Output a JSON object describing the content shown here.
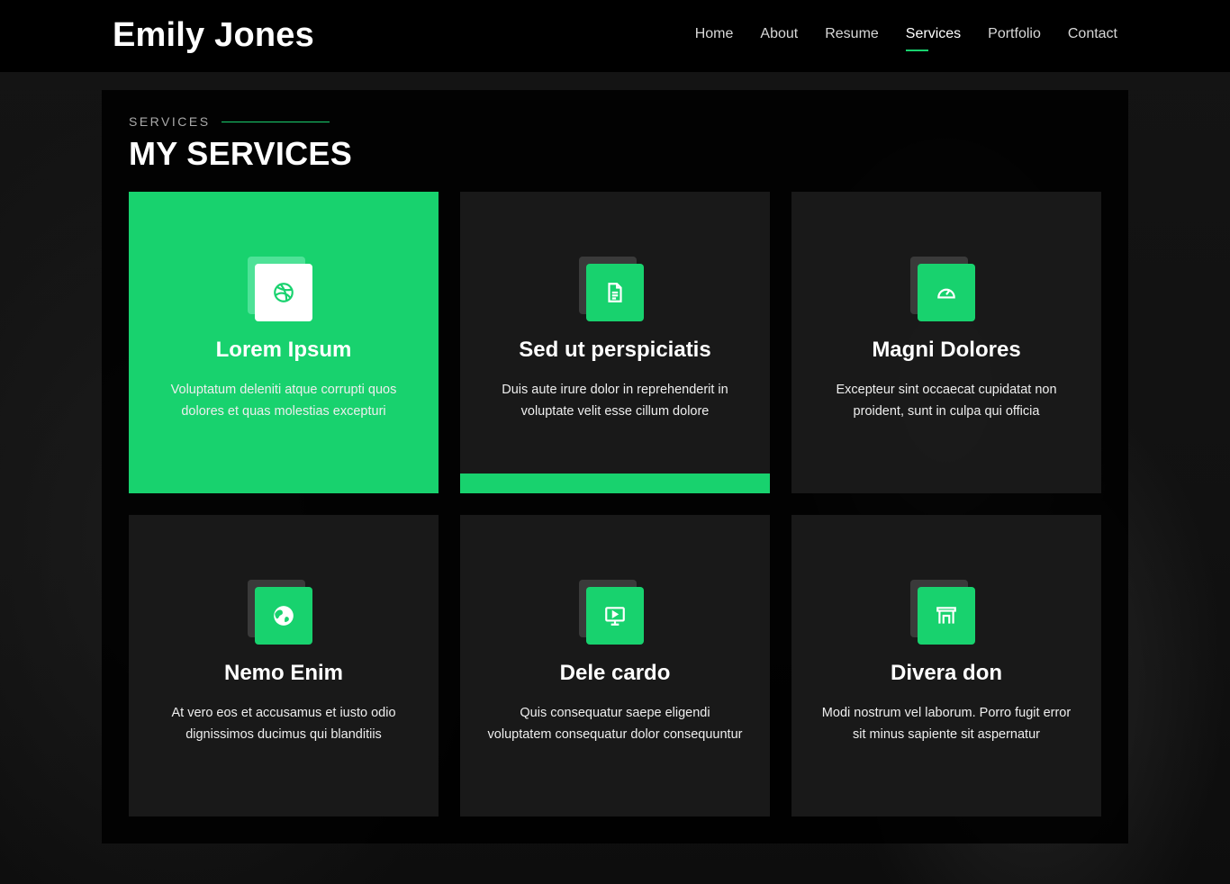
{
  "header": {
    "logo": "Emily Jones",
    "nav": [
      {
        "label": "Home"
      },
      {
        "label": "About"
      },
      {
        "label": "Resume"
      },
      {
        "label": "Services",
        "active": true
      },
      {
        "label": "Portfolio"
      },
      {
        "label": "Contact"
      }
    ]
  },
  "section": {
    "kicker": "SERVICES",
    "title": "MY SERVICES"
  },
  "colors": {
    "accent": "#18d26e",
    "background": "#000000",
    "card": "#1e1e1e"
  },
  "services": [
    {
      "title": "Lorem Ipsum",
      "text": "Voluptatum deleniti atque corrupti quos dolores et quas molestias excepturi",
      "icon": "dribbble-icon"
    },
    {
      "title": "Sed ut perspiciatis",
      "text": "Duis aute irure dolor in reprehenderit in voluptate velit esse cillum dolore",
      "icon": "document-icon"
    },
    {
      "title": "Magni Dolores",
      "text": "Excepteur sint occaecat cupidatat non proident, sunt in culpa qui officia",
      "icon": "speedometer-icon"
    },
    {
      "title": "Nemo Enim",
      "text": "At vero eos et accusamus et iusto odio dignissimos ducimus qui blanditiis",
      "icon": "globe-icon"
    },
    {
      "title": "Dele cardo",
      "text": "Quis consequatur saepe eligendi voluptatem consequatur dolor consequuntur",
      "icon": "presentation-icon"
    },
    {
      "title": "Divera don",
      "text": "Modi nostrum vel laborum. Porro fugit error sit minus sapiente sit aspernatur",
      "icon": "arch-icon"
    }
  ]
}
